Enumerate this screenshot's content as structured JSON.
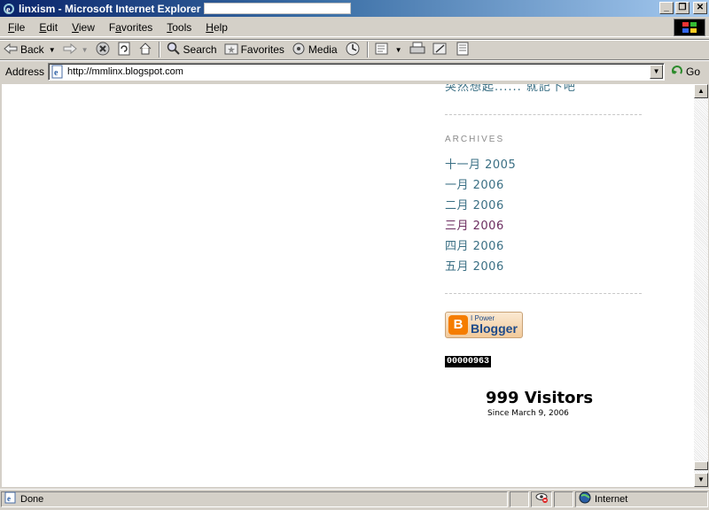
{
  "window": {
    "title": "linxism - Microsoft Internet Explorer",
    "controls": {
      "minimize": "_",
      "maximize": "❐",
      "close": "✕"
    }
  },
  "menu": {
    "items": [
      {
        "key": "F",
        "rest": "ile"
      },
      {
        "key": "E",
        "rest": "dit"
      },
      {
        "key": "V",
        "rest": "iew"
      },
      {
        "key": "F",
        "rest": "avorites",
        "prefix": ""
      },
      {
        "key": "T",
        "rest": "ools"
      },
      {
        "key": "H",
        "rest": "elp"
      }
    ]
  },
  "toolbar": {
    "back_label": "Back",
    "search_label": "Search",
    "favorites_label": "Favorites",
    "media_label": "Media"
  },
  "address": {
    "label": "Address",
    "url": "http://mmlinx.blogspot.com",
    "go_label": "Go"
  },
  "sidebar": {
    "cut_link": "突然想起...... 就記下吧",
    "archives_title": "ARCHIVES",
    "archives": [
      {
        "label": "十一月 2005",
        "visited": false
      },
      {
        "label": "一月 2006",
        "visited": false
      },
      {
        "label": "二月 2006",
        "visited": false
      },
      {
        "label": "三月 2006",
        "visited": true
      },
      {
        "label": "四月 2006",
        "visited": false
      },
      {
        "label": "五月 2006",
        "visited": false
      }
    ],
    "badge_small": "I Power",
    "badge_big": "Blogger",
    "counter": "00000963",
    "visitors": "999 Visitors",
    "since": "Since March 9, 2006"
  },
  "status": {
    "text": "Done",
    "zone": "Internet"
  },
  "colors": {
    "link": "#3a6f84",
    "visited": "#6b2c5f",
    "title_gradient_start": "#0a246a"
  }
}
